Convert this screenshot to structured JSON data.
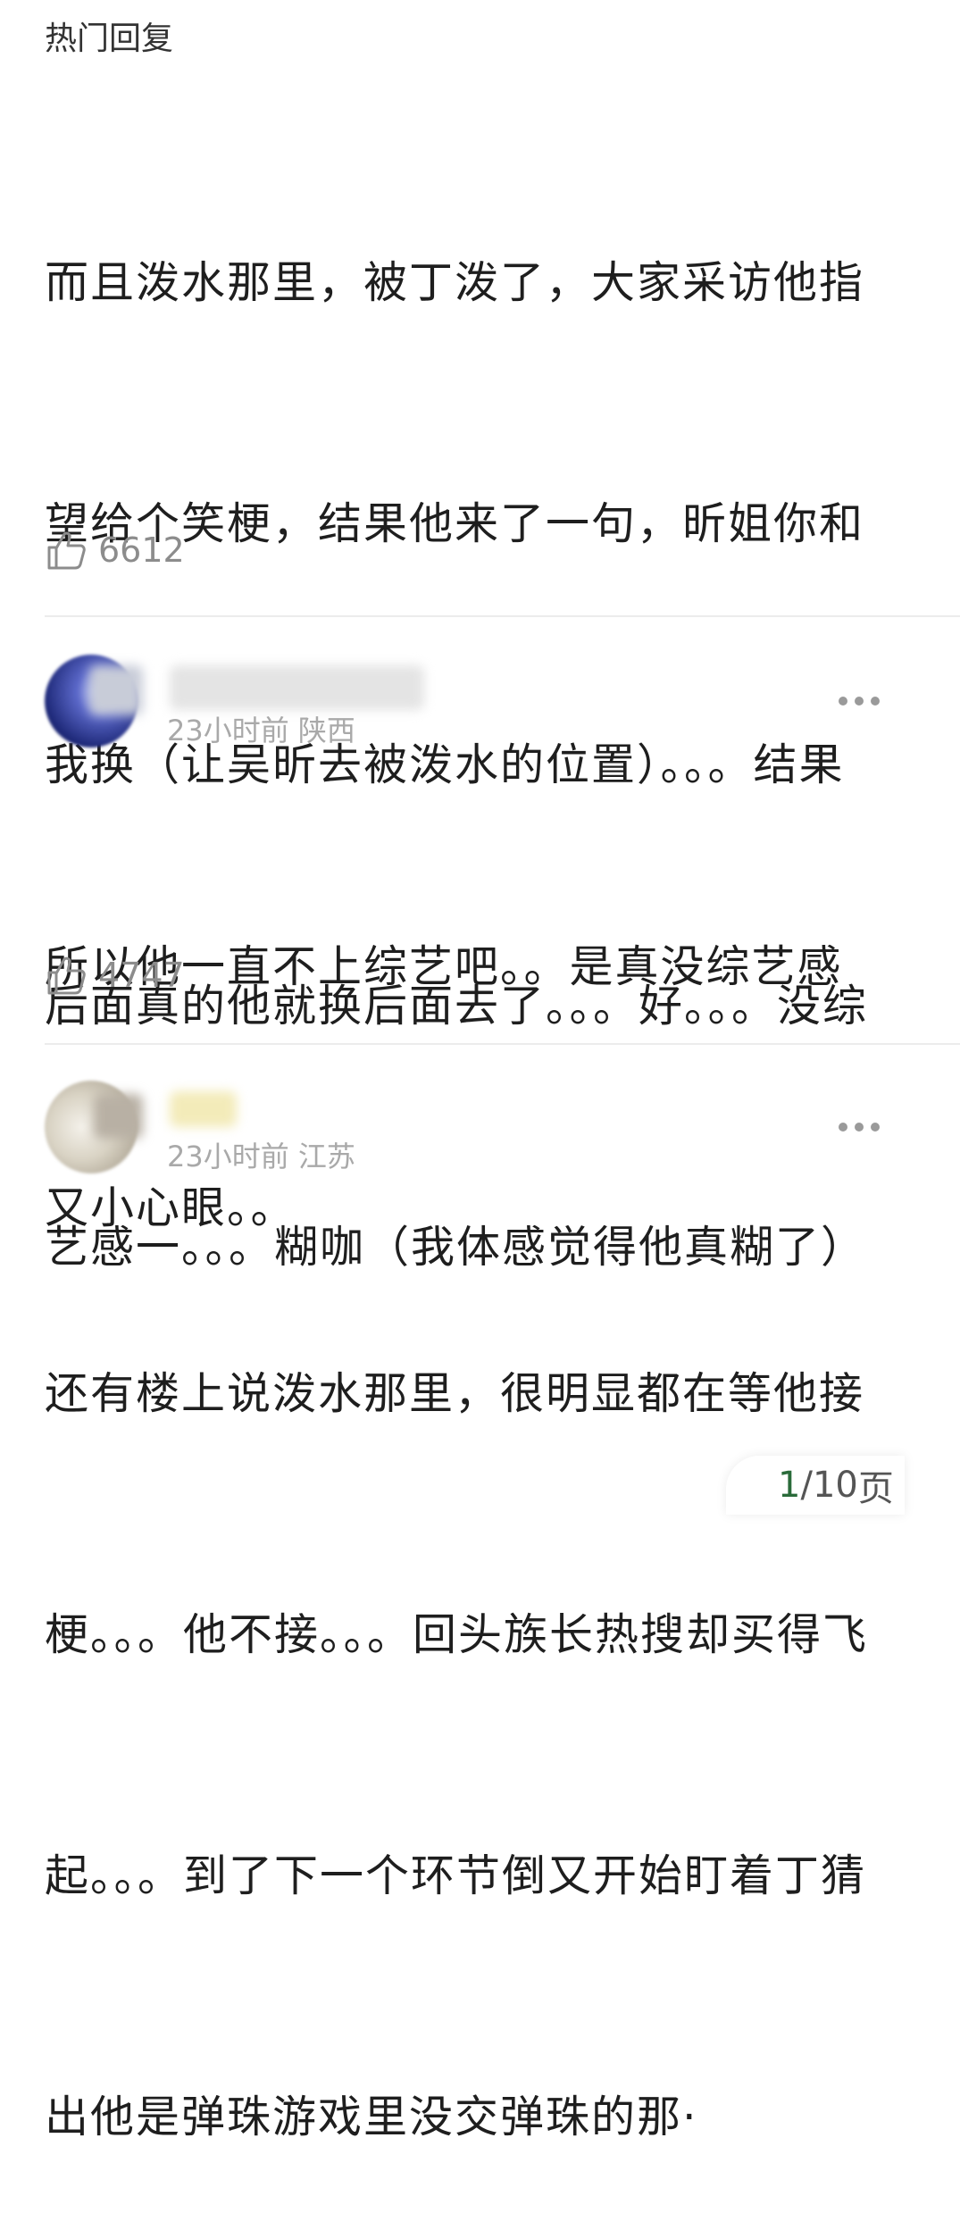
{
  "section_title": "热门回复",
  "comments": [
    {
      "lines": [
        "而且泼水那里，被丁泼了，大家采访他指",
        "望给个笑梗，结果他来了一句，昕姐你和",
        "我换（让吴昕去被泼水的位置）。。。结果",
        "后面真的他就换后面去了。。。好。。。没综",
        "艺感一。。。糊咖（我体感觉得他真糊了）"
      ],
      "likes": "6612"
    },
    {
      "time": "23小时前",
      "location": "陕西",
      "lines": [
        "所以他一直不上综艺吧。。是真没综艺感",
        "又小心眼。。"
      ],
      "likes": "4747"
    },
    {
      "time": "23小时前",
      "location": "江苏",
      "lines": [
        "还有楼上说泼水那里，很明显都在等他接",
        "梗。。。他不接。。。回头族长热搜却买得飞",
        "起。。。到了下一个环节倒又开始盯着丁猜",
        "出他是弹珠游戏里没交弹珠的那·"
      ]
    }
  ],
  "pagination": {
    "current": "1",
    "separator": "/",
    "total": "10",
    "unit": "页"
  },
  "colors": {
    "text": "#1e1e1e",
    "meta": "#a9a9a9",
    "divider": "#ececec"
  },
  "icons": [
    "thumbs-up-icon",
    "more-dots-icon"
  ]
}
